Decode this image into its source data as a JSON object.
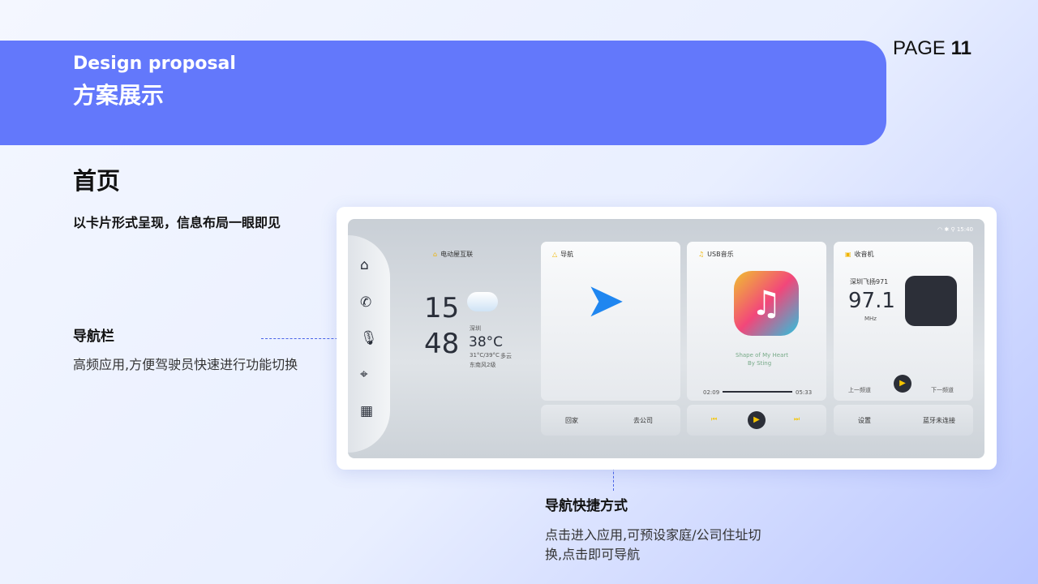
{
  "header": {
    "en": "Design proposal",
    "cn": "方案展示",
    "page_prefix": "PAGE",
    "page_num": "11"
  },
  "title": "首页",
  "subtitle": "以卡片形式呈现，信息布局一眼即见",
  "callouts": {
    "nav_title": "导航栏",
    "nav_desc": "高频应用,方便驾驶员快速进行功能切换",
    "short_title": "导航快捷方式",
    "short_desc": "点击进入应用,可预设家庭/公司住址切换,点击即可导航"
  },
  "ui": {
    "time": "15:40",
    "weather": {
      "head": "电动屋互联",
      "hour": "15",
      "min": "48",
      "city": "深圳",
      "temp": "38°C",
      "range": "31°C/39°C",
      "cond": "多云",
      "wind": "东南风2级"
    },
    "nav_card": {
      "head": "导航",
      "home": "回家",
      "work": "去公司"
    },
    "music": {
      "head": "USB音乐",
      "song": "Shape of My Heart",
      "artist": "By Sting",
      "cur": "02:09",
      "total": "05:33"
    },
    "radio": {
      "head": "收音机",
      "station": "深圳飞扬971",
      "freq": "97.1",
      "unit": "MHz",
      "prev": "上一频道",
      "next": "下一频道",
      "settings": "设置",
      "bt": "蓝牙未连接"
    }
  }
}
